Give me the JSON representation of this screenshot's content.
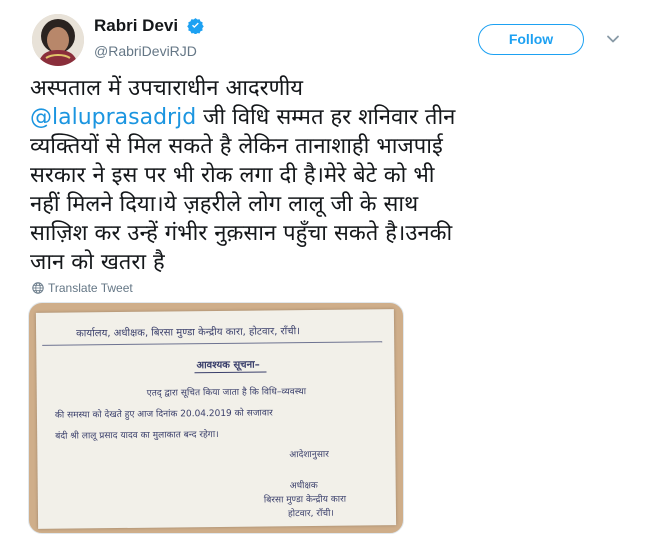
{
  "user": {
    "display_name": "Rabri Devi",
    "handle": "@RabriDeviRJD",
    "verified_icon": "verified-badge-icon",
    "avatar_icon": "profile-photo"
  },
  "actions": {
    "follow_label": "Follow",
    "menu_icon": "chevron-down-icon"
  },
  "tweet": {
    "line1": "अस्पताल में उपचाराधीन आदरणीय",
    "mention": "@laluprasadrjd",
    "line2_rest": " जी विधि सम्मत हर शनिवार तीन",
    "line3": "व्यक्तियों से मिल सकते है लेकिन तानाशाही भाजपाई",
    "line4": "सरकार ने इस पर भी रोक लगा दी है।मेरे बेटे को भी",
    "line5": "नहीं मिलने दिया।ये ज़हरीले लोग लालू जी के साथ",
    "line6": "साज़िश कर उन्हें गंभीर नुक़सान पहुँचा सकते है।उनकी",
    "line7": "जान को खतरा है",
    "translate_label": "Translate Tweet"
  },
  "notice_photo": {
    "header": "कार्यालय, अधीक्षक, बिरसा मुण्डा केन्द्रीय कारा, होटवार, राँची।",
    "title": "आवश्यक सूचना–",
    "body_line1": "एतद् द्वारा सूचित किया जाता है कि विधि–व्यवस्था",
    "body_line2": "की समस्या को देखते हुए आज दिनांक 20.04.2019 को सजावार",
    "body_line3": "बंदी श्री लालू प्रसाद यादव का मुलाकात बन्द रहेगा।",
    "order": "आदेशानुसार",
    "sign1": "अधीक्षक",
    "sign2": "बिरसा मुण्डा केन्द्रीय कारा",
    "sign3": "होटवार, राँची।"
  },
  "colors": {
    "accent": "#1da1f2",
    "mention": "#1b95e0",
    "secondary_text": "#657786"
  }
}
